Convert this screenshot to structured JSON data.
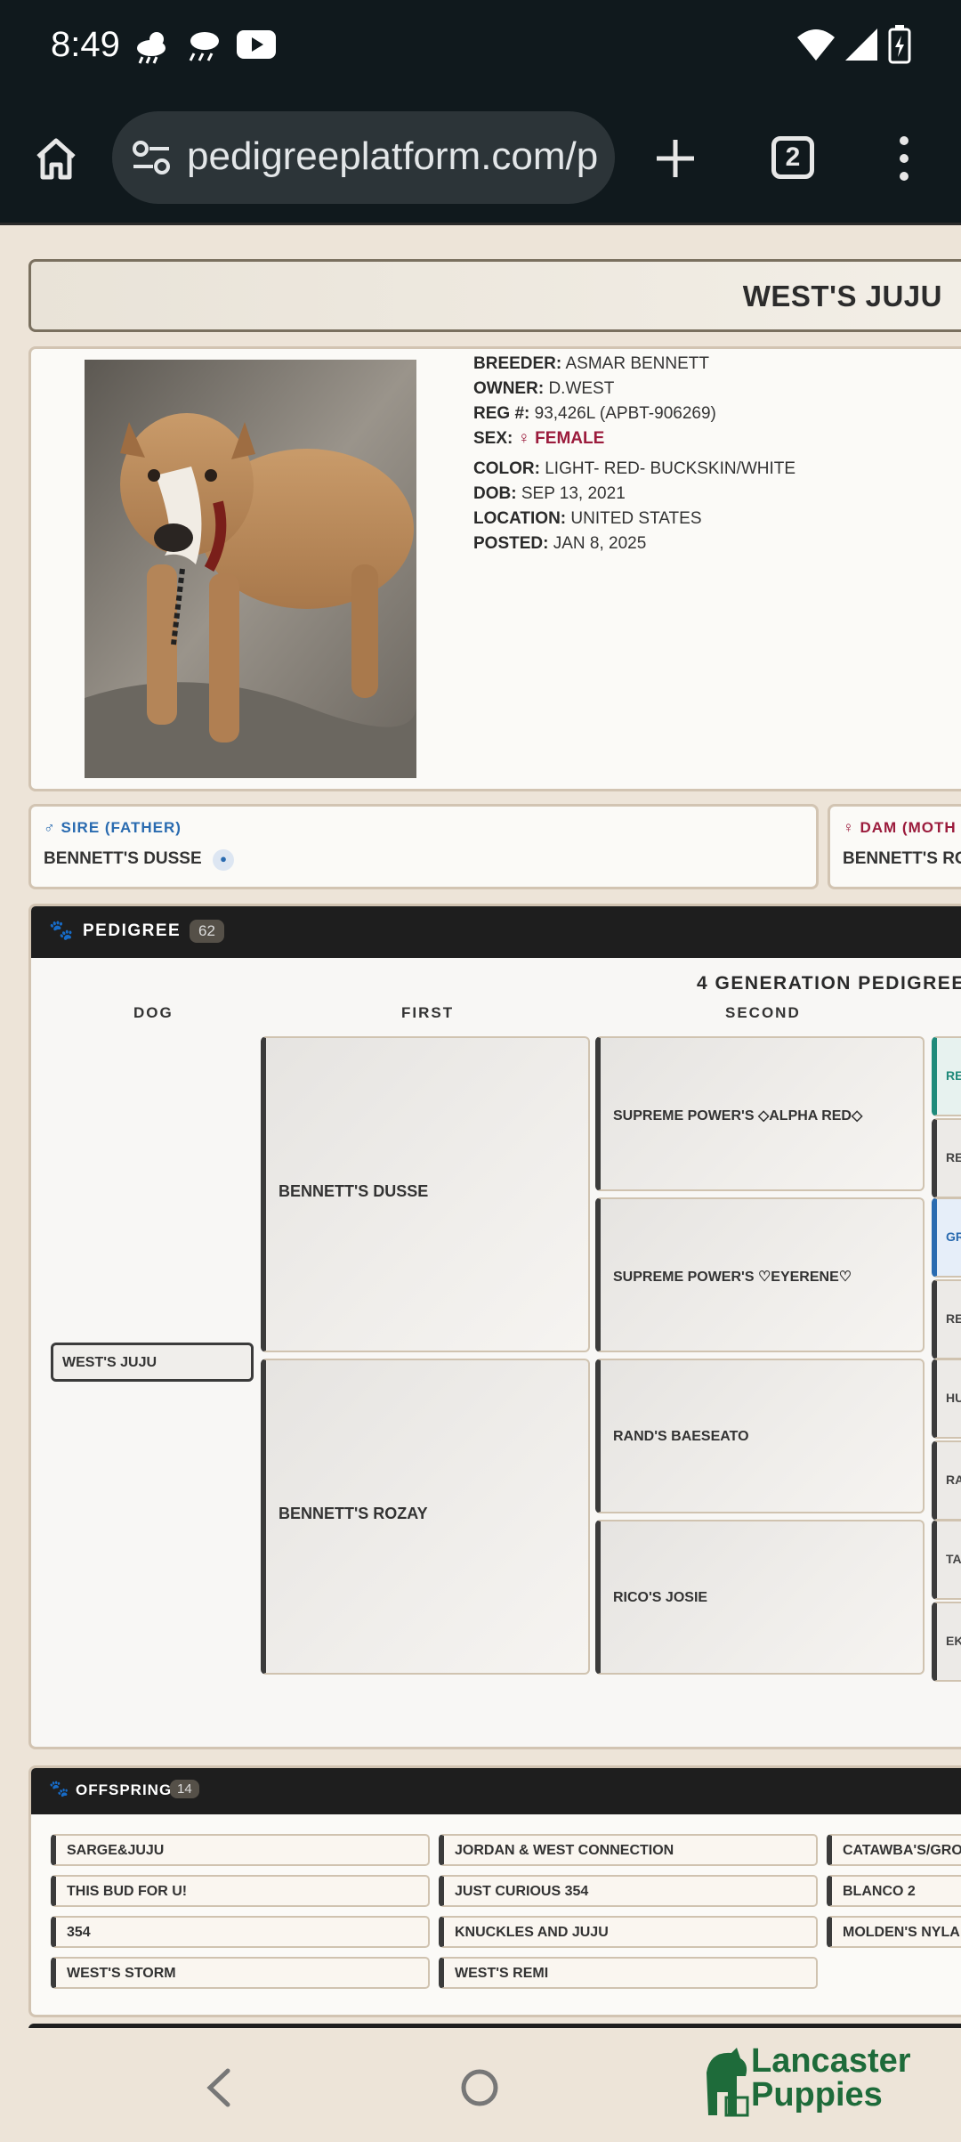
{
  "status": {
    "time": "8:49"
  },
  "browser": {
    "url": "pedigreeplatform.com/p",
    "tab_count": "2"
  },
  "page": {
    "title": "WEST'S JUJU"
  },
  "dog": {
    "breeder_label": "BREEDER:",
    "breeder": "ASMAR BENNETT",
    "owner_label": "OWNER:",
    "owner": "D.WEST",
    "reg_label": "REG #:",
    "reg": "93,426L (APBT-906269)",
    "sex_label": "SEX:",
    "sex": "FEMALE",
    "color_label": "COLOR:",
    "color": "LIGHT- RED- BUCKSKIN/WHITE",
    "dob_label": "DOB:",
    "dob": "SEP 13, 2021",
    "location_label": "LOCATION:",
    "location": "UNITED STATES",
    "posted_label": "POSTED:",
    "posted": "JAN 8, 2025"
  },
  "sire": {
    "label": "SIRE (FATHER)",
    "name": "BENNETT'S DUSSE"
  },
  "dam": {
    "label": "DAM (MOTH",
    "name": "BENNETT'S RO"
  },
  "pedigree": {
    "header": "PEDIGREE",
    "count": "62",
    "subtitle": "4 GENERATION PEDIGREE",
    "col_dog": "DOG",
    "col_first": "FIRST",
    "col_second": "SECOND",
    "dog": "WEST'S JUJU",
    "first": [
      "BENNETT'S DUSSE",
      "BENNETT'S ROZAY"
    ],
    "second": [
      "SUPREME POWER'S ◇ALPHA RED◇",
      "SUPREME POWER'S ♡EYERENE♡",
      "RAND'S BAESEATO",
      "RICO'S JOSIE"
    ],
    "third": [
      "RE",
      "RE",
      "GR",
      "RE",
      "HU",
      "RA",
      "TA",
      "EK"
    ]
  },
  "offspring": {
    "header": "OFFSPRING",
    "count": "14",
    "items": [
      "SARGE&JUJU",
      "JORDAN & WEST CONNECTION",
      "CATAWBA'S/GRO",
      "THIS BUD FOR U!",
      "JUST CURIOUS 354",
      "BLANCO 2",
      "354",
      "KNUCKLES AND JUJU",
      "MOLDEN'S NYLA",
      "WEST'S STORM",
      "WEST'S REMI"
    ]
  },
  "watermark": {
    "line1": "Lancaster",
    "line2": "Puppies"
  },
  "colors": {
    "accent_female": "#9b1b3c",
    "accent_male": "#2a6bb0",
    "header_dark": "#1e1e1e"
  }
}
